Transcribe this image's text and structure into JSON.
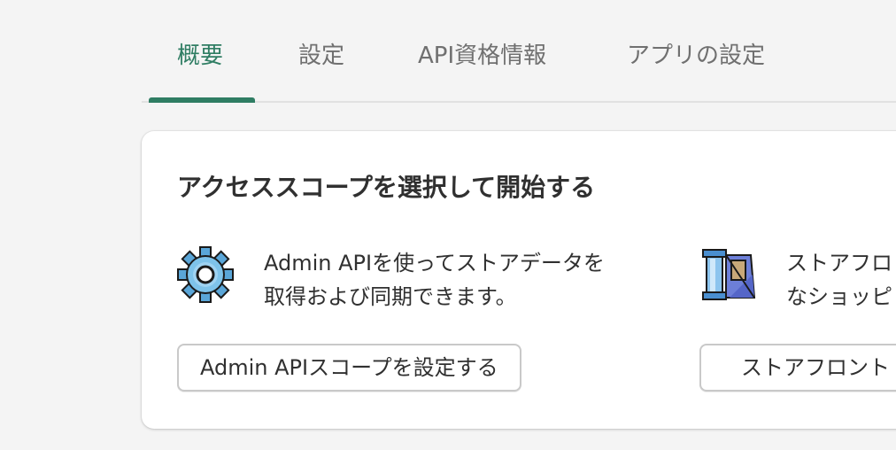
{
  "tabs": [
    {
      "label": "概要",
      "active": true
    },
    {
      "label": "設定",
      "active": false
    },
    {
      "label": "API資格情報",
      "active": false
    },
    {
      "label": "アプリの設定",
      "active": false
    }
  ],
  "card": {
    "title": "アクセススコープを選択して開始する",
    "options": [
      {
        "icon": "gear-icon",
        "description": "Admin APIを使ってストアデータを\n取得および同期できます。",
        "button_label": "Admin APIスコープを設定する"
      },
      {
        "icon": "storefront-icon",
        "description": "ストアフロ\nなショッピ",
        "button_label": "ストアフロント"
      }
    ]
  },
  "colors": {
    "accent": "#2f7d63",
    "tab_inactive": "#707070",
    "background": "#f4f4f4",
    "card": "#ffffff"
  }
}
